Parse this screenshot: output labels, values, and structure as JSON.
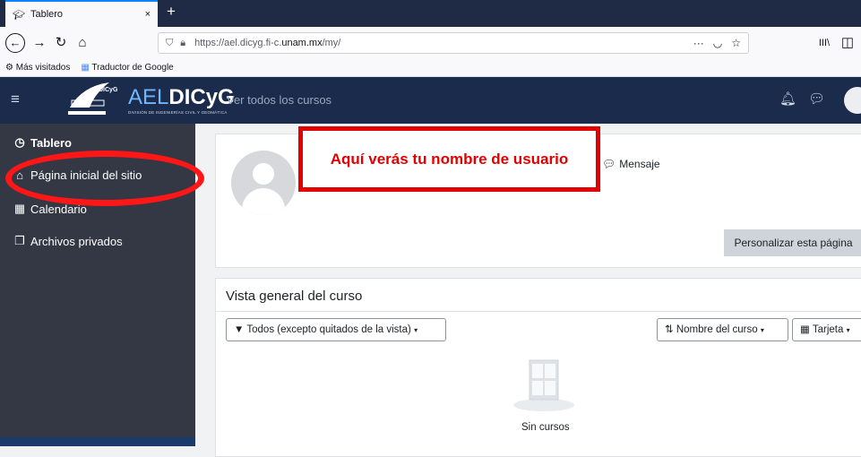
{
  "browser": {
    "tab_title": "Tablero",
    "tab_close": "×",
    "new_tab": "+",
    "url_prefix": "https://ael.dicyg.fi-c.",
    "url_domain": "unam.mx",
    "url_path": "/my/",
    "bookmarks": [
      "Más visitados",
      "Traductor de Google"
    ],
    "page_actions": "···",
    "library_icon": "III\\"
  },
  "navbar": {
    "brand_light": "AEL",
    "brand_bold": "DICyG",
    "brand_subtitle": "DIVISIÓN DE INGENIERÍAS CIVIL Y GEOMÁTICA",
    "logo_text": "DICyG",
    "see_all_courses": "Ver todos los cursos",
    "colors": {
      "bar": "#1a2b4c",
      "brand_accent": "#6fb6ff"
    }
  },
  "sidebar": {
    "items": [
      {
        "label": "Tablero",
        "icon": "dashboard-gauge-icon"
      },
      {
        "label": "Página inicial del sitio",
        "icon": "home-icon"
      },
      {
        "label": "Calendario",
        "icon": "calendar-icon"
      },
      {
        "label": "Archivos privados",
        "icon": "files-icon"
      }
    ],
    "highlight_color": "#ff1616"
  },
  "profile": {
    "message_label": "Mensaje",
    "customize_button": "Personalizar esta página"
  },
  "callout": {
    "text": "Aquí verás tu nombre de usuario",
    "color": "#e40000"
  },
  "course_overview": {
    "title": "Vista general del curso",
    "filter_label": "Todos (excepto quitados de la vista)",
    "sort_label": "Nombre del curso",
    "view_label": "Tarjeta",
    "empty_text": "Sin cursos"
  }
}
